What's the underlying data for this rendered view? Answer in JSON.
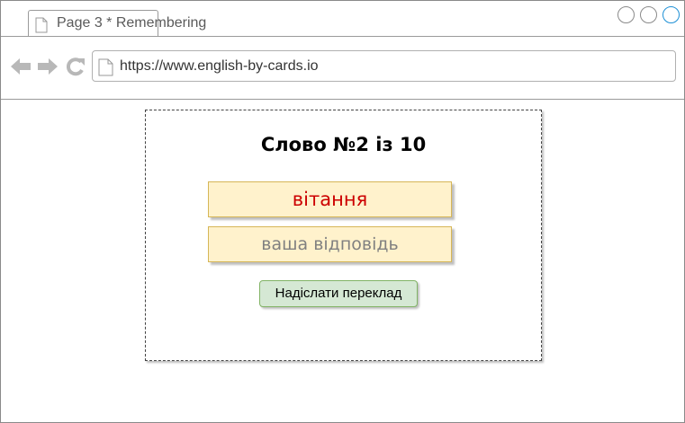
{
  "browser": {
    "tab_title": "Page 3 * Remembering",
    "url": "https://www.english-by-cards.io",
    "window_controls": [
      "minimize-icon",
      "maximize-icon",
      "close-icon"
    ],
    "nav_icons": [
      "back-arrow-icon",
      "forward-arrow-icon",
      "refresh-icon"
    ]
  },
  "card": {
    "title": "Слово №2 із 10",
    "word": "вітання",
    "answer_placeholder": "ваша відповідь",
    "submit_label": "Надіслати переклад"
  },
  "colors": {
    "word_text": "#cc0000",
    "answer_box_fill": "#fff2cc",
    "answer_box_border": "#d6b656",
    "submit_fill": "#d5e8d4",
    "submit_border": "#82b366",
    "active_window_control": "#1e90d6"
  }
}
